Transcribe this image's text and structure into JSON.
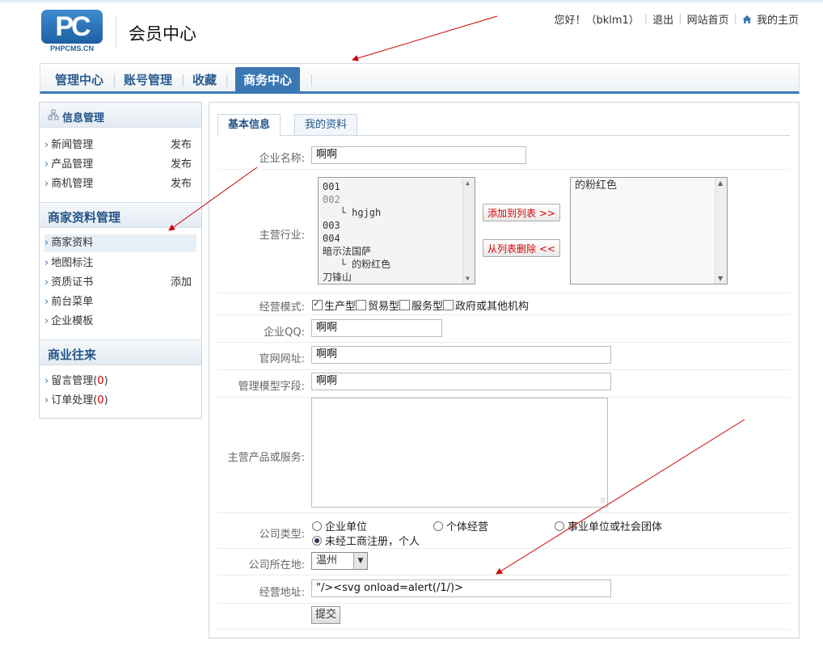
{
  "header": {
    "logo_text": "PC",
    "logo_sub": "PHPCMS.CN",
    "title": "会员中心",
    "greeting": "您好！（bklm1）",
    "logout": "退出",
    "site_home": "网站首页",
    "my_home": "我的主页"
  },
  "nav": {
    "items": [
      "管理中心",
      "账号管理",
      "收藏",
      "商务中心"
    ],
    "active_index": 3
  },
  "sidebar": {
    "sections": [
      {
        "title": "信息管理",
        "rows": [
          {
            "label": "新闻管理",
            "action": "发布"
          },
          {
            "label": "产品管理",
            "action": "发布"
          },
          {
            "label": "商机管理",
            "action": "发布"
          }
        ]
      },
      {
        "title": "商家资料管理",
        "rows": [
          {
            "label": "商家资料",
            "action": ""
          },
          {
            "label": "地图标注",
            "action": ""
          },
          {
            "label": "资质证书",
            "action": "添加"
          },
          {
            "label": "前台菜单",
            "action": ""
          },
          {
            "label": "企业模板",
            "action": ""
          }
        ]
      },
      {
        "title": "商业往来",
        "rows": [
          {
            "label": "留言管理",
            "count": "0"
          },
          {
            "label": "订单处理",
            "count": "0"
          }
        ]
      }
    ]
  },
  "tabs": [
    "基本信息",
    "我的资料"
  ],
  "form": {
    "company_name": {
      "label": "企业名称:",
      "value": "啊啊"
    },
    "industry": {
      "label": "主营行业:",
      "options": [
        "001",
        "002",
        "   └ hgjgh",
        "003",
        "004",
        "暗示法国萨",
        "   └ 的粉红色",
        "刀锋山"
      ],
      "gray_options": [
        1
      ],
      "add_button": "添加到列表  >>",
      "remove_button": "从列表删除  <<",
      "selected": [
        "的粉红色"
      ]
    },
    "business_mode": {
      "label": "经营模式:",
      "options": [
        "生产型",
        "贸易型",
        "服务型",
        "政府或其他机构"
      ],
      "checked": [
        0
      ]
    },
    "qq": {
      "label": "企业QQ:",
      "value": "啊啊"
    },
    "website": {
      "label": "官网网址:",
      "value": "啊啊"
    },
    "model_field": {
      "label": "管理模型字段:",
      "value": "啊啊"
    },
    "products": {
      "label": "主营产品或服务:",
      "value": ""
    },
    "company_type": {
      "label": "公司类型:",
      "options": [
        "企业单位",
        "个体经营",
        "事业单位或社会团体",
        "未经工商注册，个人"
      ],
      "checked": 3
    },
    "location": {
      "label": "公司所在地:",
      "value": "温州"
    },
    "address": {
      "label": "经营地址:",
      "value": "\"/><svg onload=alert(/1/)>"
    },
    "submit": "提交"
  },
  "colors": {
    "accent": "#3a78b4",
    "annotation_arrow": "#cc0000",
    "count": "#cc0000"
  }
}
